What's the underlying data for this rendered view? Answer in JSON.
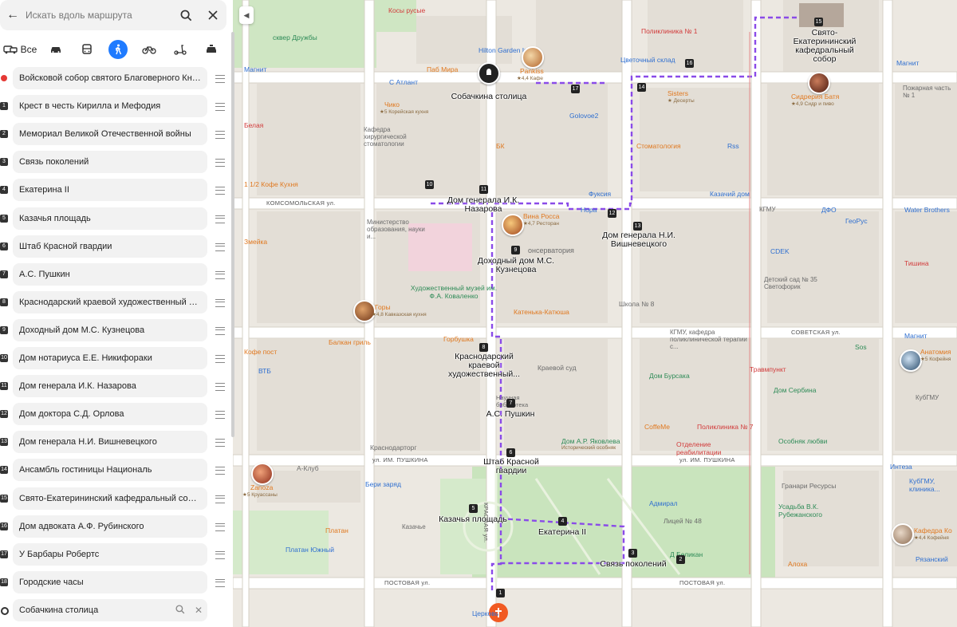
{
  "search": {
    "placeholder": "Искать вдоль маршрута"
  },
  "modes": {
    "all_label": "Все",
    "active": "pedestrian"
  },
  "waypoints": [
    {
      "num": "",
      "label": "Войсковой собор святого Благоверного Князя Александра Невского"
    },
    {
      "num": "1",
      "label": "Крест в честь Кирилла и Мефодия"
    },
    {
      "num": "2",
      "label": "Мемориал Великой Отечественной войны"
    },
    {
      "num": "3",
      "label": "Связь поколений"
    },
    {
      "num": "4",
      "label": "Екатерина II"
    },
    {
      "num": "5",
      "label": "Казачья площадь"
    },
    {
      "num": "6",
      "label": "Штаб Красной гвардии"
    },
    {
      "num": "7",
      "label": "А.С. Пушкин"
    },
    {
      "num": "8",
      "label": "Краснодарский краевой художественный музей им. Ф.А. Коваленко"
    },
    {
      "num": "9",
      "label": "Доходный дом М.С. Кузнецова"
    },
    {
      "num": "10",
      "label": "Дом нотариуса Е.Е. Никифораки"
    },
    {
      "num": "11",
      "label": "Дом генерала И.К. Назарова"
    },
    {
      "num": "12",
      "label": "Дом доктора С.Д. Орлова"
    },
    {
      "num": "13",
      "label": "Дом генерала Н.И. Вишневецкого"
    },
    {
      "num": "14",
      "label": "Ансамбль гостиницы Националь"
    },
    {
      "num": "15",
      "label": "Свято-Екатерининский кафедральный собор"
    },
    {
      "num": "16",
      "label": "Дом адвоката А.Ф. Рубинского"
    },
    {
      "num": "17",
      "label": "У Барбары Робертс"
    },
    {
      "num": "18",
      "label": "Городские часы"
    },
    {
      "num": "",
      "label": "Собачкина столица"
    }
  ],
  "map": {
    "streets": [
      "КОМСОМОЛЬСКАЯ ул.",
      "СОВЕТСКАЯ ул.",
      "ул. ИМ. ПУШКИНА",
      "ул. ИМ. ПУШКИНА",
      "ПОСТОВАЯ ул.",
      "ПОСТОВАЯ ул.",
      "КРАСНАЯ ул."
    ],
    "route_labels": [
      "Собачкина столица",
      "Свято-Екатерининский кафедральный собор",
      "Дом генерала И.К. Назарова",
      "Дом генерала Н.И. Вишневецкого",
      "Доходный дом М.С. Кузнецова",
      "Краснодарский краевой художественный...",
      "А.С. Пушкин",
      "Штаб Красной гвардии",
      "Казачья площадь",
      "Екатерина II",
      "Связь поколений"
    ],
    "route_markers": [
      "1",
      "2",
      "3",
      "4",
      "5",
      "6",
      "7",
      "8",
      "9",
      "10",
      "11",
      "12",
      "13",
      "14",
      "15",
      "16",
      "17"
    ],
    "pois": [
      {
        "name": "Pankiss",
        "sub": "★4,4 Кафе",
        "color": "#e0781f"
      },
      {
        "name": "Вина Росса",
        "sub": "★4,7 Ресторан",
        "color": "#e0781f"
      },
      {
        "name": "Горы",
        "sub": "★4,8 Кавказская кухня",
        "color": "#e0781f"
      },
      {
        "name": "Сидрерия Батя",
        "sub": "★4,9 Сидр и пиво",
        "color": "#e0781f"
      },
      {
        "name": "Zanoza",
        "sub": "★5 Круассаны",
        "color": "#e0781f"
      },
      {
        "name": "Анатомия",
        "sub": "★5 Кофейня",
        "color": "#e0781f"
      },
      {
        "name": "Кафедра Ко",
        "sub": "★4,4 Кофейня",
        "color": "#e0781f"
      }
    ],
    "labels": {
      "sqer": "сквер Дружбы",
      "kosy": "Косы русые",
      "hilton": "Hilton Garden Inn",
      "pabmira": "Паб Мира",
      "satlant": "С Атлант",
      "chiko": "Чико",
      "chikosub": "★5 Корейская кухня",
      "kafedra": "Кафедра хирургической стоматологии",
      "belaya": "Белая",
      "magnit1": "Магнит",
      "poliklinika": "Поликлиника № 1",
      "cvetsklad": "Цветочный склад",
      "golovoe": "Golovoe2",
      "sisters": "Sisters",
      "sisterssub": "★ Десерты",
      "stomat": "Стоматология",
      "rss": "Rss",
      "bk": "БК",
      "kuhnia": "1 1/2 Кофе Кухня",
      "fuksia": "Фуксия",
      "nora": "Нора",
      "kazachiy": "Казачий дом",
      "kgmu": "КГМУ",
      "dfo": "ДФО",
      "georus": "ГеоРус",
      "waterbr": "Water Brothers",
      "ministr": "Министерство образования, науки и...",
      "zmeika": "Змейка",
      "konserv": "онсерватория",
      "cdek": "CDEK",
      "tishina": "Тишина",
      "detsad": "Детский сад № 35 Светофорик",
      "museum": "Художественный музей им. Ф.А. Коваленко",
      "katenka": "Катенька-Катюша",
      "shkola": "Школа № 8",
      "kgmupolik": "КГМУ, кафедра поликлинической терапии с...",
      "magnit2": "Магнит",
      "kofepost": "Кофе пост",
      "vtb": "ВТБ",
      "balkan": "Балкан гриль",
      "gorbushka": "Горбушка",
      "krsud": "Краевой суд",
      "sos": "Sos",
      "travmpunkt": "Травмпункт",
      "dombursaka": "Дом Бурсака",
      "domserbina": "Дом Сербина",
      "kubgmu": "КубГМУ",
      "biblioteka": "Научная библиотека",
      "coffeme": "CoffeMe",
      "yakovlev": "Дом А.Р. Яковлева",
      "yakovsub": "Исторический особняк",
      "poliklinika7": "Поликлиника № 7",
      "otdrea": "Отделение реабилитации",
      "osobnyak": "Особняк любви",
      "krasnodar": "Краснодарторг",
      "aklub": "А-Клуб",
      "berizar": "Бери заряд",
      "admiral": "Адмирал",
      "litsey": "Лицей № 48",
      "granary": "Гранари Ресурсы",
      "usadba": "Усадьба В.К. Рубежанского",
      "platan": "Платан",
      "platanyuzh": "Платан Южный",
      "kazakhsvet": "Казачье",
      "dbelikan": "Д Беликан",
      "aloha": "Алоха",
      "kubgmuklin": "КубГМУ, клиника...",
      "integra": "Интеза",
      "ryazhsk": "Рязанский",
      "pozharnaya": "Пожарная часть № 1",
      "magnit3": "Магнит",
      "tserkov": "Церковь"
    }
  }
}
